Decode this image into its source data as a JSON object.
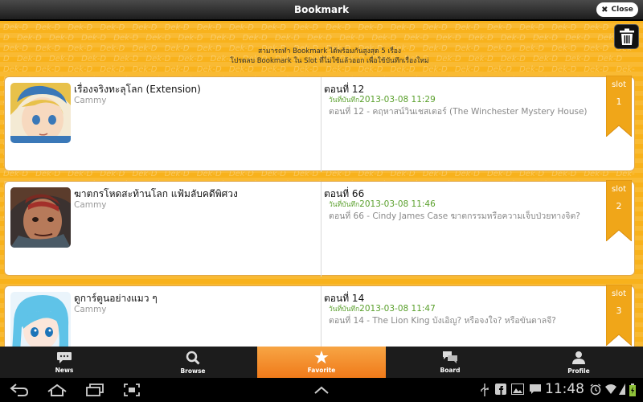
{
  "window": {
    "title": "Bookmark",
    "close_label": "Close"
  },
  "watermark_text": "Dek-D",
  "notice": {
    "line1": "สามารถทำ Bookmark ได้พร้อมกันสูงสุด 5 เรื่อง",
    "line2": "โปรดลบ Bookmark ใน Slot ที่ไม่ใช้แล้วออก เพื่อใช้บันทึกเรื่องใหม่"
  },
  "bookmarks": [
    {
      "title": "เรื่องจริงทะลุโลก (Extension)",
      "author": "Cammy",
      "episode": "ตอนที่ 12",
      "saved_label": "วันที่บันทึก",
      "saved_date": "2013-03-08 11:29",
      "description": "ตอนที่ 12 - คฤหาสน์วินเชสเตอร์ (The Winchester Mystery House)",
      "slot_label": "slot",
      "slot_number": "1",
      "thumb_icon": "blonde-anime-girl-avatar"
    },
    {
      "title": "ฆาตกรโหดสะท้านโลก แฟ้มลับคดีพิศวง",
      "author": "Cammy",
      "episode": "ตอนที่ 66",
      "saved_label": "วันที่บันทึก",
      "saved_date": "2013-03-08 11:46",
      "description": "ตอนที่ 66 - Cindy James Case ฆาตกรรมหรือความเจ็บป่วยทางจิต?",
      "slot_label": "slot",
      "slot_number": "2",
      "thumb_icon": "painted-man-portrait"
    },
    {
      "title": "ดูการ์ตูนอย่างแมว ๆ",
      "author": "Cammy",
      "episode": "ตอนที่ 14",
      "saved_label": "วันที่บันทึก",
      "saved_date": "2013-03-08 11:47",
      "description": "ตอนที่ 14 - The Lion King บังเอิญ? หรือจงใจ? หรือขันตาลจี?",
      "slot_label": "slot",
      "slot_number": "3",
      "thumb_icon": "blue-hair-anime-girl-avatar"
    }
  ],
  "nav": [
    {
      "label": "News",
      "icon": "chat-bubble-icon"
    },
    {
      "label": "Browse",
      "icon": "search-icon"
    },
    {
      "label": "Favorite",
      "icon": "star-icon"
    },
    {
      "label": "Board",
      "icon": "board-bubbles-icon"
    },
    {
      "label": "Profile",
      "icon": "person-icon"
    }
  ],
  "statusbar": {
    "time": "11:48"
  },
  "colors": {
    "background": "#f8b21c",
    "ribbon": "#f0a619",
    "active_tab": "#f07a1a",
    "saved_date": "#5aa02c"
  }
}
